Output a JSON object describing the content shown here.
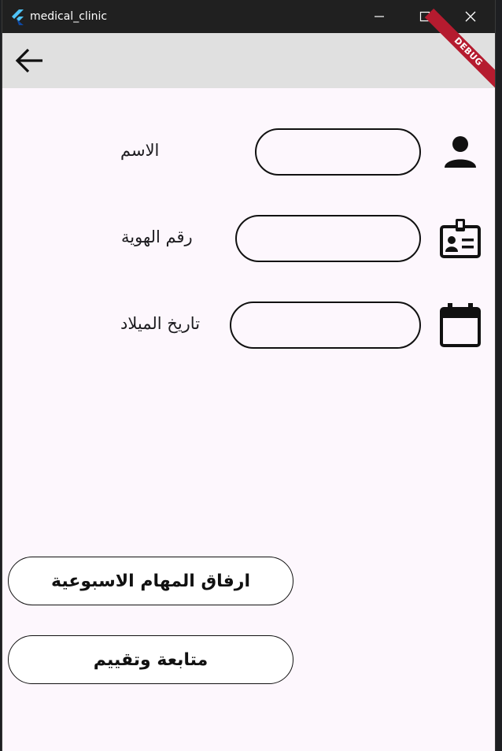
{
  "window": {
    "title": "medical_clinic",
    "debug_banner": "DEBUG"
  },
  "form": {
    "fields": [
      {
        "label": "الاسم",
        "value": "",
        "icon": "person-icon"
      },
      {
        "label": "رقم الهوية",
        "value": "",
        "icon": "id-badge-icon"
      },
      {
        "label": "تاريخ الميلاد",
        "value": "",
        "icon": "calendar-icon"
      }
    ]
  },
  "actions": {
    "attach_tasks_label": "ارفاق المهام الاسبوعية",
    "follow_up_label": "متابعة وتقييم"
  },
  "colors": {
    "background": "#fdf7fd",
    "appbar": "#e0e0e0",
    "titlebar": "#202020",
    "debug": "#b51b2f"
  }
}
